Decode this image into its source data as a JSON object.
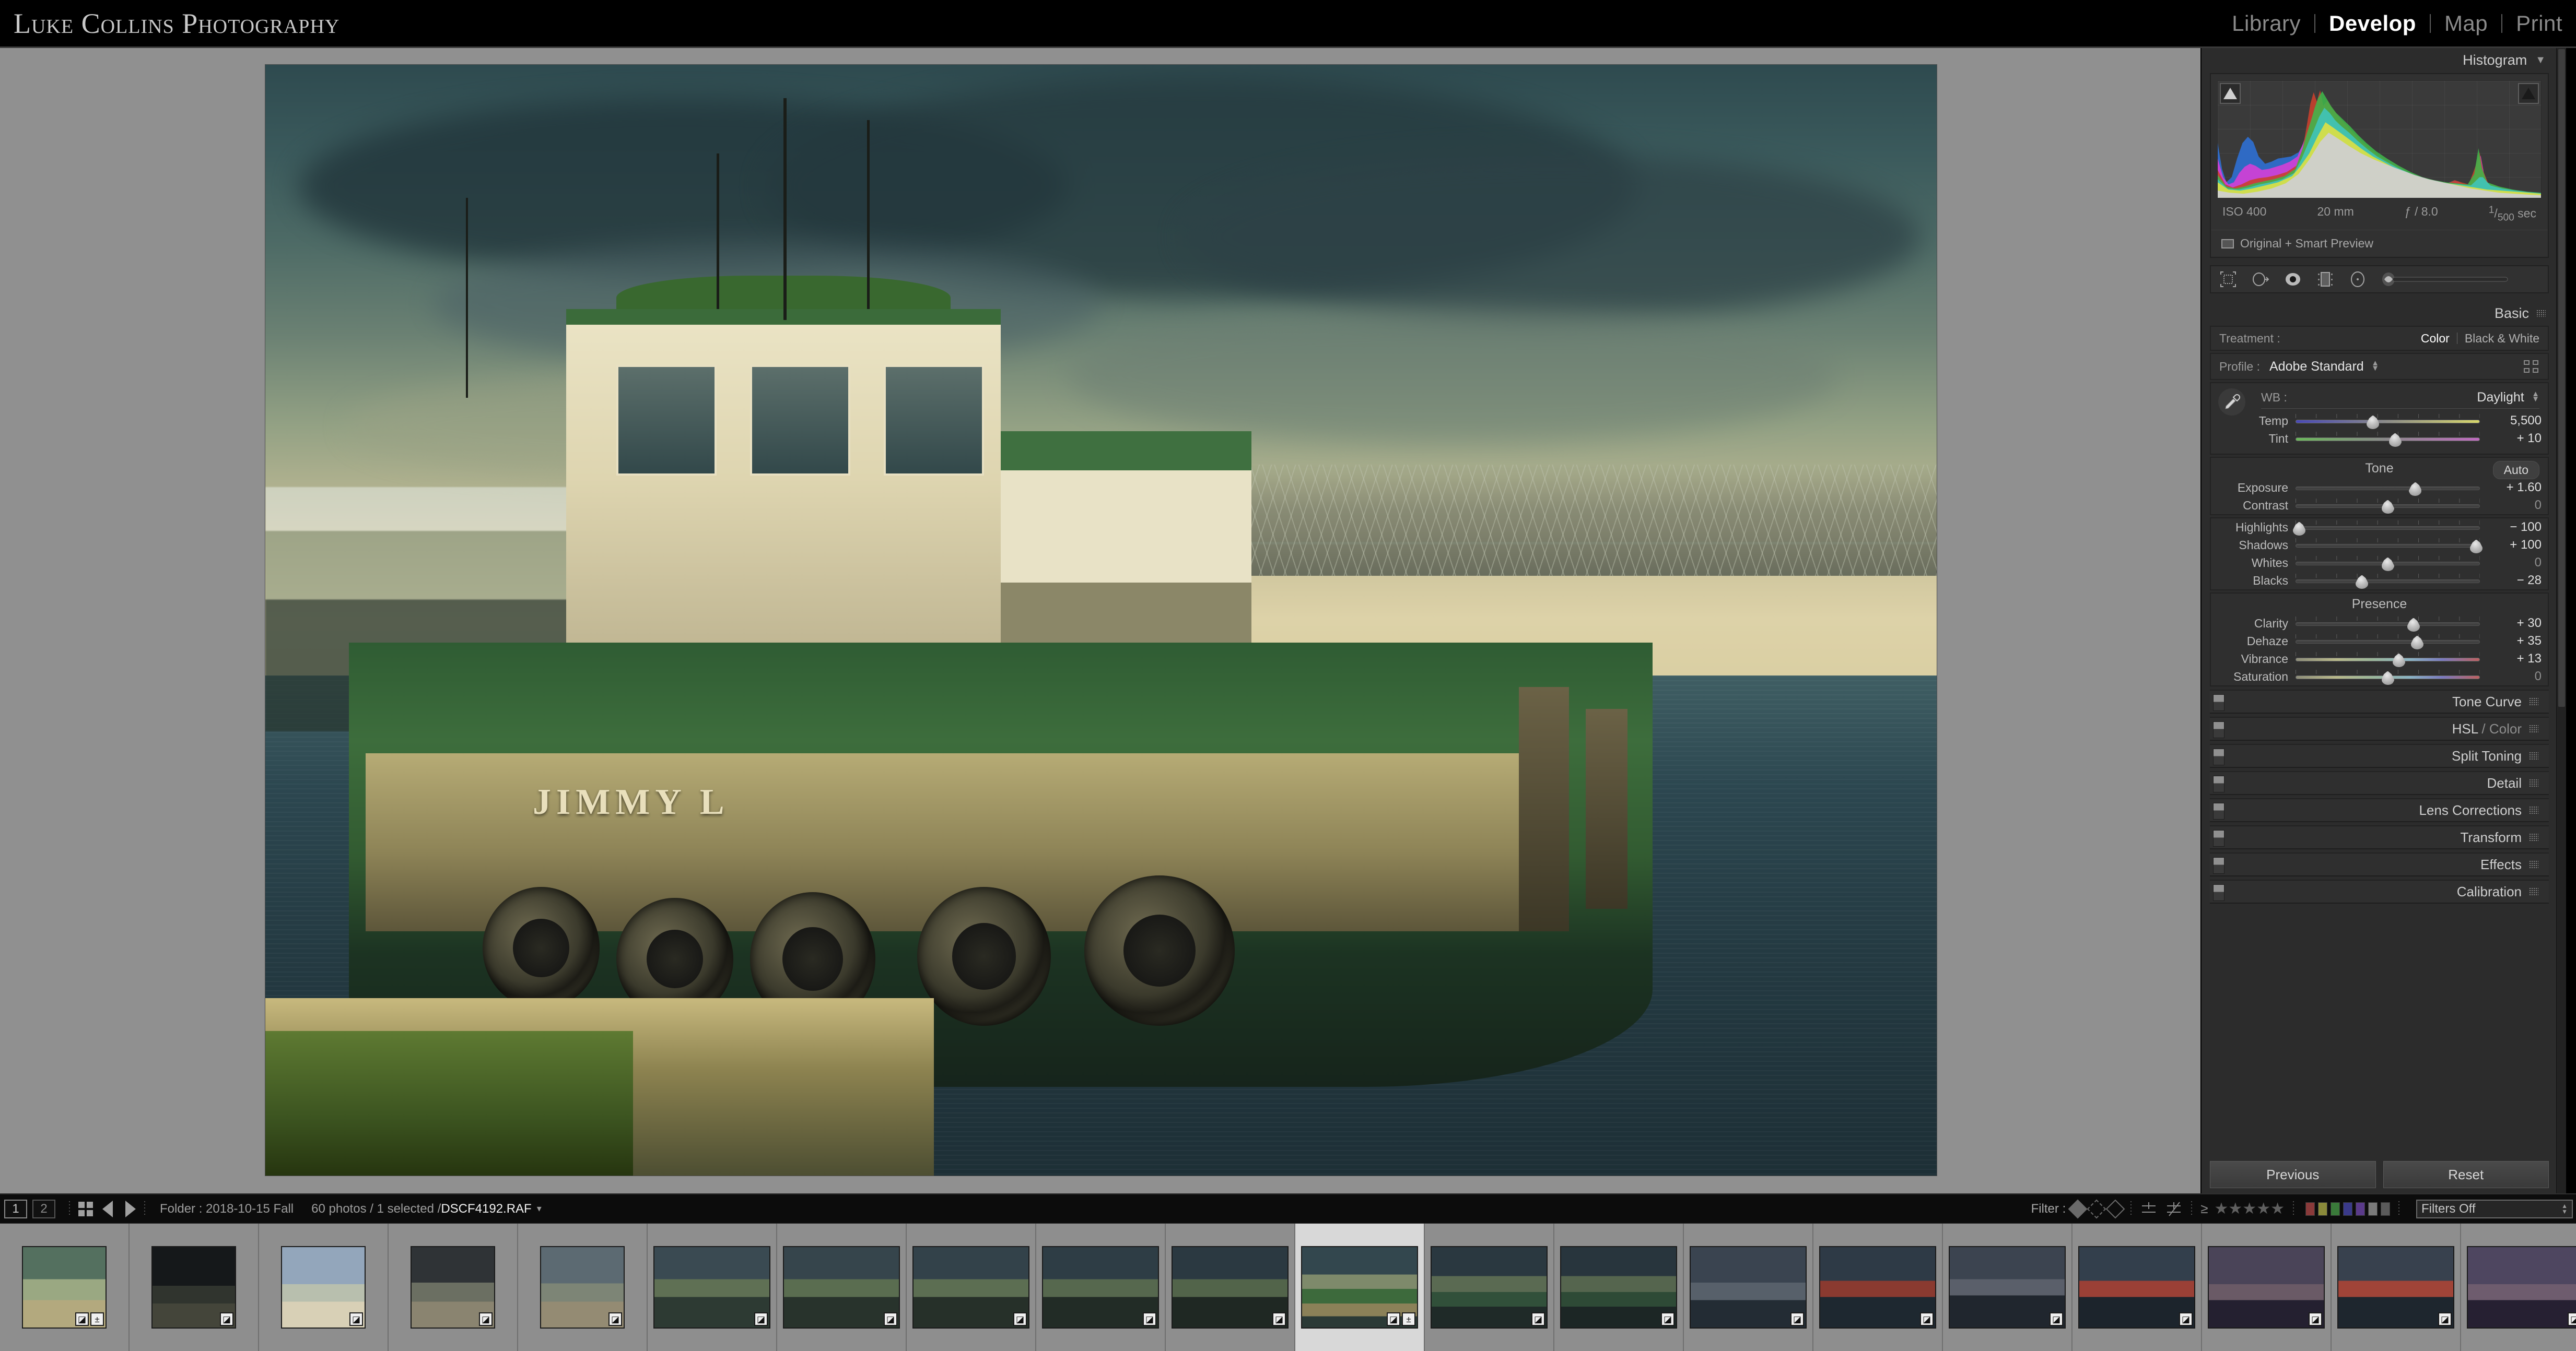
{
  "identity": {
    "name": "Luke Collins Photography"
  },
  "modules": [
    {
      "label": "Library",
      "active": false
    },
    {
      "label": "Develop",
      "active": true
    },
    {
      "label": "Map",
      "active": false
    },
    {
      "label": "Print",
      "active": false
    }
  ],
  "right_panel": {
    "histogram": {
      "title": "Histogram",
      "collapse_icon": "triangle-down-icon",
      "exif": {
        "iso": "ISO 400",
        "focal": "20 mm",
        "aperture": "ƒ / 8.0",
        "shutter_num": "1",
        "shutter_den": "500",
        "shutter_unit": "sec"
      },
      "preview_status": "Original + Smart Preview",
      "preview_icon": "smart-preview-icon",
      "clip_left_icon": "shadow-clipping-icon",
      "clip_right_icon": "highlight-clipping-icon"
    },
    "tools": [
      {
        "name": "crop-overlay-tool"
      },
      {
        "name": "spot-removal-tool"
      },
      {
        "name": "red-eye-correction-tool"
      },
      {
        "name": "graduated-filter-tool"
      },
      {
        "name": "radial-filter-tool"
      },
      {
        "name": "adjustment-brush-tool"
      }
    ],
    "basic": {
      "title": "Basic",
      "treatment_label": "Treatment :",
      "treatment_color": "Color",
      "treatment_bw": "Black & White",
      "treatment_selected": "Color",
      "profile_label": "Profile :",
      "profile_value": "Adobe Standard",
      "wb_label": "WB :",
      "wb_value": "Daylight",
      "tone_label": "Tone",
      "auto_label": "Auto",
      "presence_label": "Presence",
      "wb_sliders": [
        {
          "label": "Temp",
          "value": "5,500",
          "pos": 42,
          "track": "temp",
          "zero": false
        },
        {
          "label": "Tint",
          "value": "+ 10",
          "pos": 54,
          "track": "tint",
          "zero": false
        }
      ],
      "tone_sliders": [
        {
          "label": "Exposure",
          "value": "+ 1.60",
          "pos": 65,
          "track": "plain",
          "zero": false,
          "ticks": false
        },
        {
          "label": "Contrast",
          "value": "0",
          "pos": 50,
          "track": "plain",
          "zero": true,
          "ticks": true
        },
        {
          "label": "Highlights",
          "value": "− 100",
          "pos": 2,
          "track": "plain",
          "zero": false,
          "ticks": true
        },
        {
          "label": "Shadows",
          "value": "+ 100",
          "pos": 98,
          "track": "plain",
          "zero": false,
          "ticks": true
        },
        {
          "label": "Whites",
          "value": "0",
          "pos": 50,
          "track": "plain",
          "zero": true,
          "ticks": true
        },
        {
          "label": "Blacks",
          "value": "− 28",
          "pos": 36,
          "track": "plain",
          "zero": false,
          "ticks": true
        }
      ],
      "presence_sliders": [
        {
          "label": "Clarity",
          "value": "+ 30",
          "pos": 64,
          "track": "plain",
          "zero": false,
          "ticks": true
        },
        {
          "label": "Dehaze",
          "value": "+ 35",
          "pos": 66,
          "track": "plain",
          "zero": false,
          "ticks": true
        },
        {
          "label": "Vibrance",
          "value": "+ 13",
          "pos": 56,
          "track": "vib",
          "zero": false,
          "ticks": true
        },
        {
          "label": "Saturation",
          "value": "0",
          "pos": 50,
          "track": "vib",
          "zero": true,
          "ticks": true
        }
      ]
    },
    "collapsed_panels": [
      {
        "label": "Tone Curve",
        "dim": ""
      },
      {
        "label": "HSL ",
        "dim": "/ Color"
      },
      {
        "label": "Split Toning",
        "dim": ""
      },
      {
        "label": "Detail",
        "dim": ""
      },
      {
        "label": "Lens Corrections",
        "dim": ""
      },
      {
        "label": "Transform",
        "dim": ""
      },
      {
        "label": "Effects",
        "dim": ""
      },
      {
        "label": "Calibration",
        "dim": ""
      }
    ],
    "footer": {
      "previous": "Previous",
      "reset": "Reset"
    }
  },
  "filmstrip_bar": {
    "monitor1": "1",
    "monitor2": "2",
    "grid_icon": "grid-view-icon",
    "back_icon": "navigate-back-icon",
    "forward_icon": "navigate-forward-icon",
    "folder": "Folder : 2018-10-15 Fall",
    "count": "60 photos / 1 selected /",
    "filename": "DSCF4192.RAF",
    "filter_label": "Filter :",
    "filter_value": "Filters Off",
    "stars": "★★★★★",
    "gte": "≥",
    "color_labels": [
      "#8a3a3a",
      "#8a8a3a",
      "#3a7a3a",
      "#3a3a8a",
      "#5a3a8a",
      "#7a7a7a",
      "#5a5a5a"
    ]
  },
  "photo": {
    "subject": "Green tugboat JIMMY L at dock",
    "hull_name": "JIMMY L"
  },
  "filmstrip_thumbs": [
    {
      "tone": "warm-dock",
      "portrait": true,
      "selected": false,
      "badges": [
        "crop",
        "adj"
      ]
    },
    {
      "tone": "dark-dock",
      "portrait": true,
      "selected": false,
      "badges": [
        "crop"
      ]
    },
    {
      "tone": "bright-dock",
      "portrait": true,
      "selected": false,
      "badges": [
        "crop"
      ]
    },
    {
      "tone": "dusk-dock",
      "portrait": true,
      "selected": false,
      "badges": [
        "crop"
      ]
    },
    {
      "tone": "dim-dock",
      "portrait": true,
      "selected": false,
      "badges": [
        "crop"
      ]
    },
    {
      "tone": "tug-wide",
      "portrait": false,
      "selected": false,
      "badges": [
        "crop"
      ]
    },
    {
      "tone": "tug-wide",
      "portrait": false,
      "selected": false,
      "badges": [
        "crop"
      ]
    },
    {
      "tone": "tug-wide",
      "portrait": false,
      "selected": false,
      "badges": [
        "crop"
      ]
    },
    {
      "tone": "tug-wide",
      "portrait": false,
      "selected": false,
      "badges": [
        "crop"
      ]
    },
    {
      "tone": "tug-wide",
      "portrait": false,
      "selected": false,
      "badges": [
        "crop"
      ]
    },
    {
      "tone": "tug-main",
      "portrait": false,
      "selected": true,
      "badges": [
        "crop",
        "adj"
      ]
    },
    {
      "tone": "tug-dark",
      "portrait": false,
      "selected": false,
      "badges": [
        "crop"
      ]
    },
    {
      "tone": "tug-dark",
      "portrait": false,
      "selected": false,
      "badges": [
        "crop"
      ]
    },
    {
      "tone": "water-dusk",
      "portrait": false,
      "selected": false,
      "badges": [
        "crop"
      ]
    },
    {
      "tone": "red-boat",
      "portrait": false,
      "selected": false,
      "badges": [
        "crop"
      ]
    },
    {
      "tone": "rail-dusk",
      "portrait": false,
      "selected": false,
      "badges": [
        "crop"
      ]
    },
    {
      "tone": "red-boat",
      "portrait": false,
      "selected": false,
      "badges": [
        "crop"
      ]
    },
    {
      "tone": "purple-dusk",
      "portrait": false,
      "selected": false,
      "badges": [
        "crop"
      ]
    },
    {
      "tone": "red-boat",
      "portrait": false,
      "selected": false,
      "badges": [
        "crop"
      ]
    },
    {
      "tone": "purple-dusk",
      "portrait": false,
      "selected": false,
      "badges": [
        "crop"
      ]
    }
  ]
}
